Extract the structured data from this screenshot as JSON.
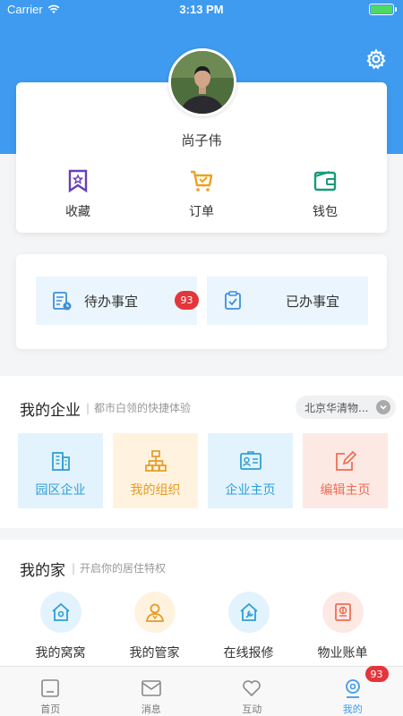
{
  "status_bar": {
    "carrier": "Carrier",
    "time": "3:13 PM"
  },
  "profile": {
    "username": "尚子伟",
    "quick_actions": [
      {
        "label": "收藏",
        "icon": "bookmark-star-icon",
        "color": "#6a3fb5"
      },
      {
        "label": "订单",
        "icon": "shopping-cart-icon",
        "color": "#f0a020"
      },
      {
        "label": "钱包",
        "icon": "wallet-icon",
        "color": "#1a9a7a"
      }
    ]
  },
  "tasks": {
    "pending_label": "待办事宜",
    "pending_count": "93",
    "done_label": "已办事宜"
  },
  "enterprise": {
    "title": "我的企业",
    "subtitle": "都市白领的快捷体验",
    "company_select": "北京华清物...",
    "tiles": [
      {
        "label": "园区企业",
        "icon": "building-icon",
        "color": "#2f9fd6"
      },
      {
        "label": "我的组织",
        "icon": "org-chart-icon",
        "color": "#e69a24"
      },
      {
        "label": "企业主页",
        "icon": "id-card-icon",
        "color": "#2f9fd6"
      },
      {
        "label": "编辑主页",
        "icon": "edit-icon",
        "color": "#ef6d55"
      }
    ]
  },
  "home": {
    "title": "我的家",
    "subtitle": "开启你的居住特权",
    "items": [
      {
        "label": "我的窝窝",
        "icon": "house-icon"
      },
      {
        "label": "我的管家",
        "icon": "butler-icon"
      },
      {
        "label": "在线报修",
        "icon": "repair-icon"
      },
      {
        "label": "物业账单",
        "icon": "bill-icon"
      }
    ]
  },
  "tabbar": {
    "tabs": [
      {
        "label": "首页",
        "icon": "home-tab-icon"
      },
      {
        "label": "消息",
        "icon": "message-tab-icon"
      },
      {
        "label": "互动",
        "icon": "heart-tab-icon"
      },
      {
        "label": "我的",
        "icon": "profile-tab-icon",
        "active": true
      }
    ],
    "badge": "93"
  },
  "colors": {
    "accent": "#3e9bf0",
    "badge": "#e4353b"
  }
}
